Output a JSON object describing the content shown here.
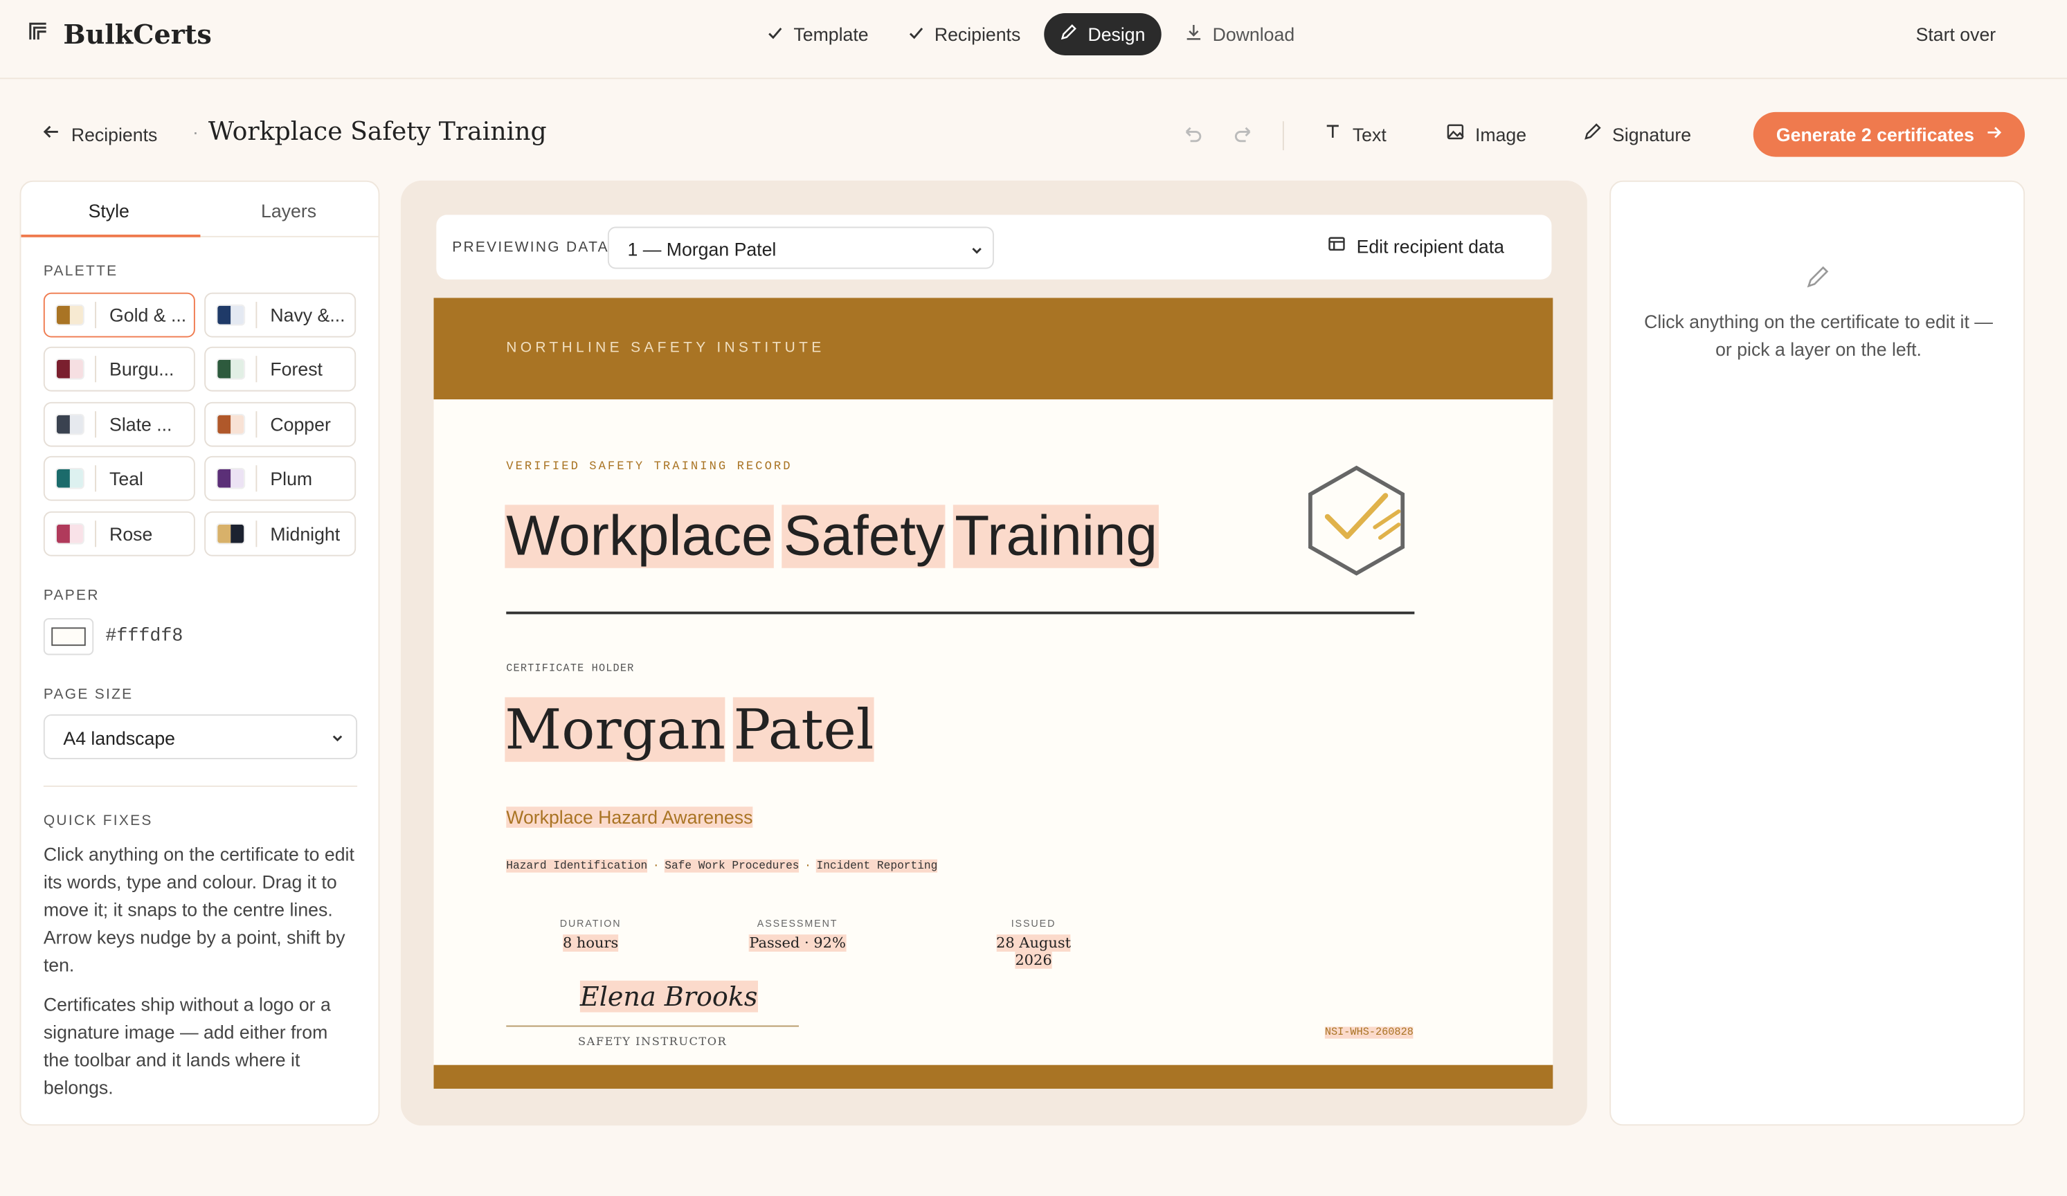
{
  "brand": {
    "name": "BulkCerts",
    "icon": "stacked-pages-icon"
  },
  "steps": [
    {
      "label": "Template",
      "icon": "check-icon",
      "state": "done"
    },
    {
      "label": "Recipients",
      "icon": "check-icon",
      "state": "done"
    },
    {
      "label": "Design",
      "icon": "pencil-icon",
      "state": "active"
    },
    {
      "label": "Download",
      "icon": "download-icon",
      "state": "upcoming"
    }
  ],
  "header": {
    "start_over": "Start over"
  },
  "subbar": {
    "back_label": "Recipients",
    "separator": "·",
    "title": "Workplace Safety Training",
    "tools": {
      "text": "Text",
      "image": "Image",
      "signature": "Signature"
    },
    "generate": "Generate 2 certificates"
  },
  "left_panel": {
    "tabs": [
      "Style",
      "Layers"
    ],
    "active_tab": "Style",
    "palette_label": "PALETTE",
    "palettes": [
      {
        "label": "Gold & ...",
        "colors": [
          "#a97424",
          "#f7ead2"
        ],
        "selected": true
      },
      {
        "label": "Navy &...",
        "colors": [
          "#1f3a68",
          "#e4e9f2"
        ]
      },
      {
        "label": "Burgu...",
        "colors": [
          "#7a1f2e",
          "#f6dfe2"
        ]
      },
      {
        "label": "Forest",
        "colors": [
          "#2d5a3d",
          "#e2efe5"
        ]
      },
      {
        "label": "Slate ...",
        "colors": [
          "#3a4250",
          "#e6e9ee"
        ]
      },
      {
        "label": "Copper",
        "colors": [
          "#b0582a",
          "#f8e2d5"
        ]
      },
      {
        "label": "Teal",
        "colors": [
          "#1b6b6b",
          "#ddf1f0"
        ]
      },
      {
        "label": "Plum",
        "colors": [
          "#5b2f77",
          "#ece3f4"
        ]
      },
      {
        "label": "Rose",
        "colors": [
          "#b03a5b",
          "#f9e2e8"
        ]
      },
      {
        "label": "Midnight",
        "colors": [
          "#d8b16a",
          "#1c2230"
        ]
      }
    ],
    "paper_label": "PAPER",
    "paper_value": "#fffdf8",
    "page_size_label": "PAGE SIZE",
    "page_size_value": "A4 landscape",
    "quick_fixes_label": "QUICK FIXES",
    "quick_fixes_p1": "Click anything on the certificate to edit its words, type and colour. Drag it to move it; it snaps to the centre lines. Arrow keys nudge by a point, shift by ten.",
    "quick_fixes_p2": "Certificates ship without a logo or a signature image — add either from the toolbar and it lands where it belongs."
  },
  "preview": {
    "label": "PREVIEWING DATA",
    "selected": "1 — Morgan Patel",
    "edit_data": "Edit recipient data"
  },
  "certificate": {
    "institute": "NORTHLINE SAFETY INSTITUTE",
    "verified": "VERIFIED SAFETY TRAINING RECORD",
    "title_words": [
      "Workplace",
      "Safety",
      "Training"
    ],
    "holder_label": "CERTIFICATE HOLDER",
    "holder_words": [
      "Morgan",
      "Patel"
    ],
    "course": "Workplace Hazard Awareness",
    "topics": [
      "Hazard Identification",
      "Safe Work Procedures",
      "Incident Reporting"
    ],
    "topic_sep": "·",
    "meta": [
      {
        "label": "DURATION",
        "value": "8 hours"
      },
      {
        "label": "ASSESSMENT",
        "value": "Passed · 92%"
      },
      {
        "label": "ISSUED",
        "value": "28 August 2026"
      }
    ],
    "signature_name": "Elena Brooks",
    "signature_role": "SAFETY INSTRUCTOR",
    "cert_id": "NSI-WHS-260828",
    "accent": "#a97424",
    "highlight": "#fbdacb"
  },
  "right_panel": {
    "icon": "pencil-icon",
    "hint": "Click anything on the certificate to edit it — or pick a layer on the left."
  },
  "colors": {
    "accent": "#ef7a4e",
    "background": "#fcf7f2",
    "dark": "#2b2b2b"
  }
}
